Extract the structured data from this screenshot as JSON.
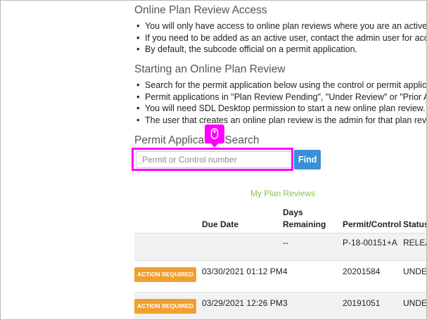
{
  "access_section": {
    "title": "Online Plan Review Access",
    "bullets": [
      "You will only have access to online plan reviews where you are an active user.",
      "If you need to be added as an active user, contact the admin user for access.",
      "By default, the subcode official on a permit application."
    ]
  },
  "start_section": {
    "title": "Starting an Online Plan Review",
    "bullets": [
      "Search for the permit application below using the control or permit application",
      "Permit applications in \"Plan Review Pending\", \"Under Review\" or \"Prior Approv",
      "You will need SDL Desktop permission to start a new online plan review.",
      "The user that creates an online plan review is the admin for that plan review."
    ]
  },
  "search": {
    "title": "Permit Application Search",
    "placeholder": "Permit or Control number",
    "value": "",
    "button_label": "Find"
  },
  "my_reviews_link": "My Plan Reviews",
  "table": {
    "headers": {
      "badge": "",
      "due_date": "Due Date",
      "days_line1": "Days",
      "days_line2": "Remaining",
      "permit": "Permit/Control",
      "status": "Status"
    },
    "rows": [
      {
        "badge": "",
        "due_date": "",
        "days": "--",
        "permit": "P-18-00151+A",
        "status": "RELEA"
      },
      {
        "badge": "ACTION REQUIRED",
        "due_date": "03/30/2021 01:12 PM",
        "days": "4",
        "permit": "20201584",
        "status": "UNDE"
      },
      {
        "badge": "ACTION REQUIRED",
        "due_date": "03/29/2021 12:26 PM",
        "days": "3",
        "permit": "20191051",
        "status": "UNDE"
      }
    ]
  },
  "icons": {
    "cursor": "mouse-pointer-icon"
  },
  "colors": {
    "highlight": "#ff00ff",
    "find_button": "#3b8fd6",
    "link": "#8bc34a",
    "action_badge": "#f0a02f"
  }
}
